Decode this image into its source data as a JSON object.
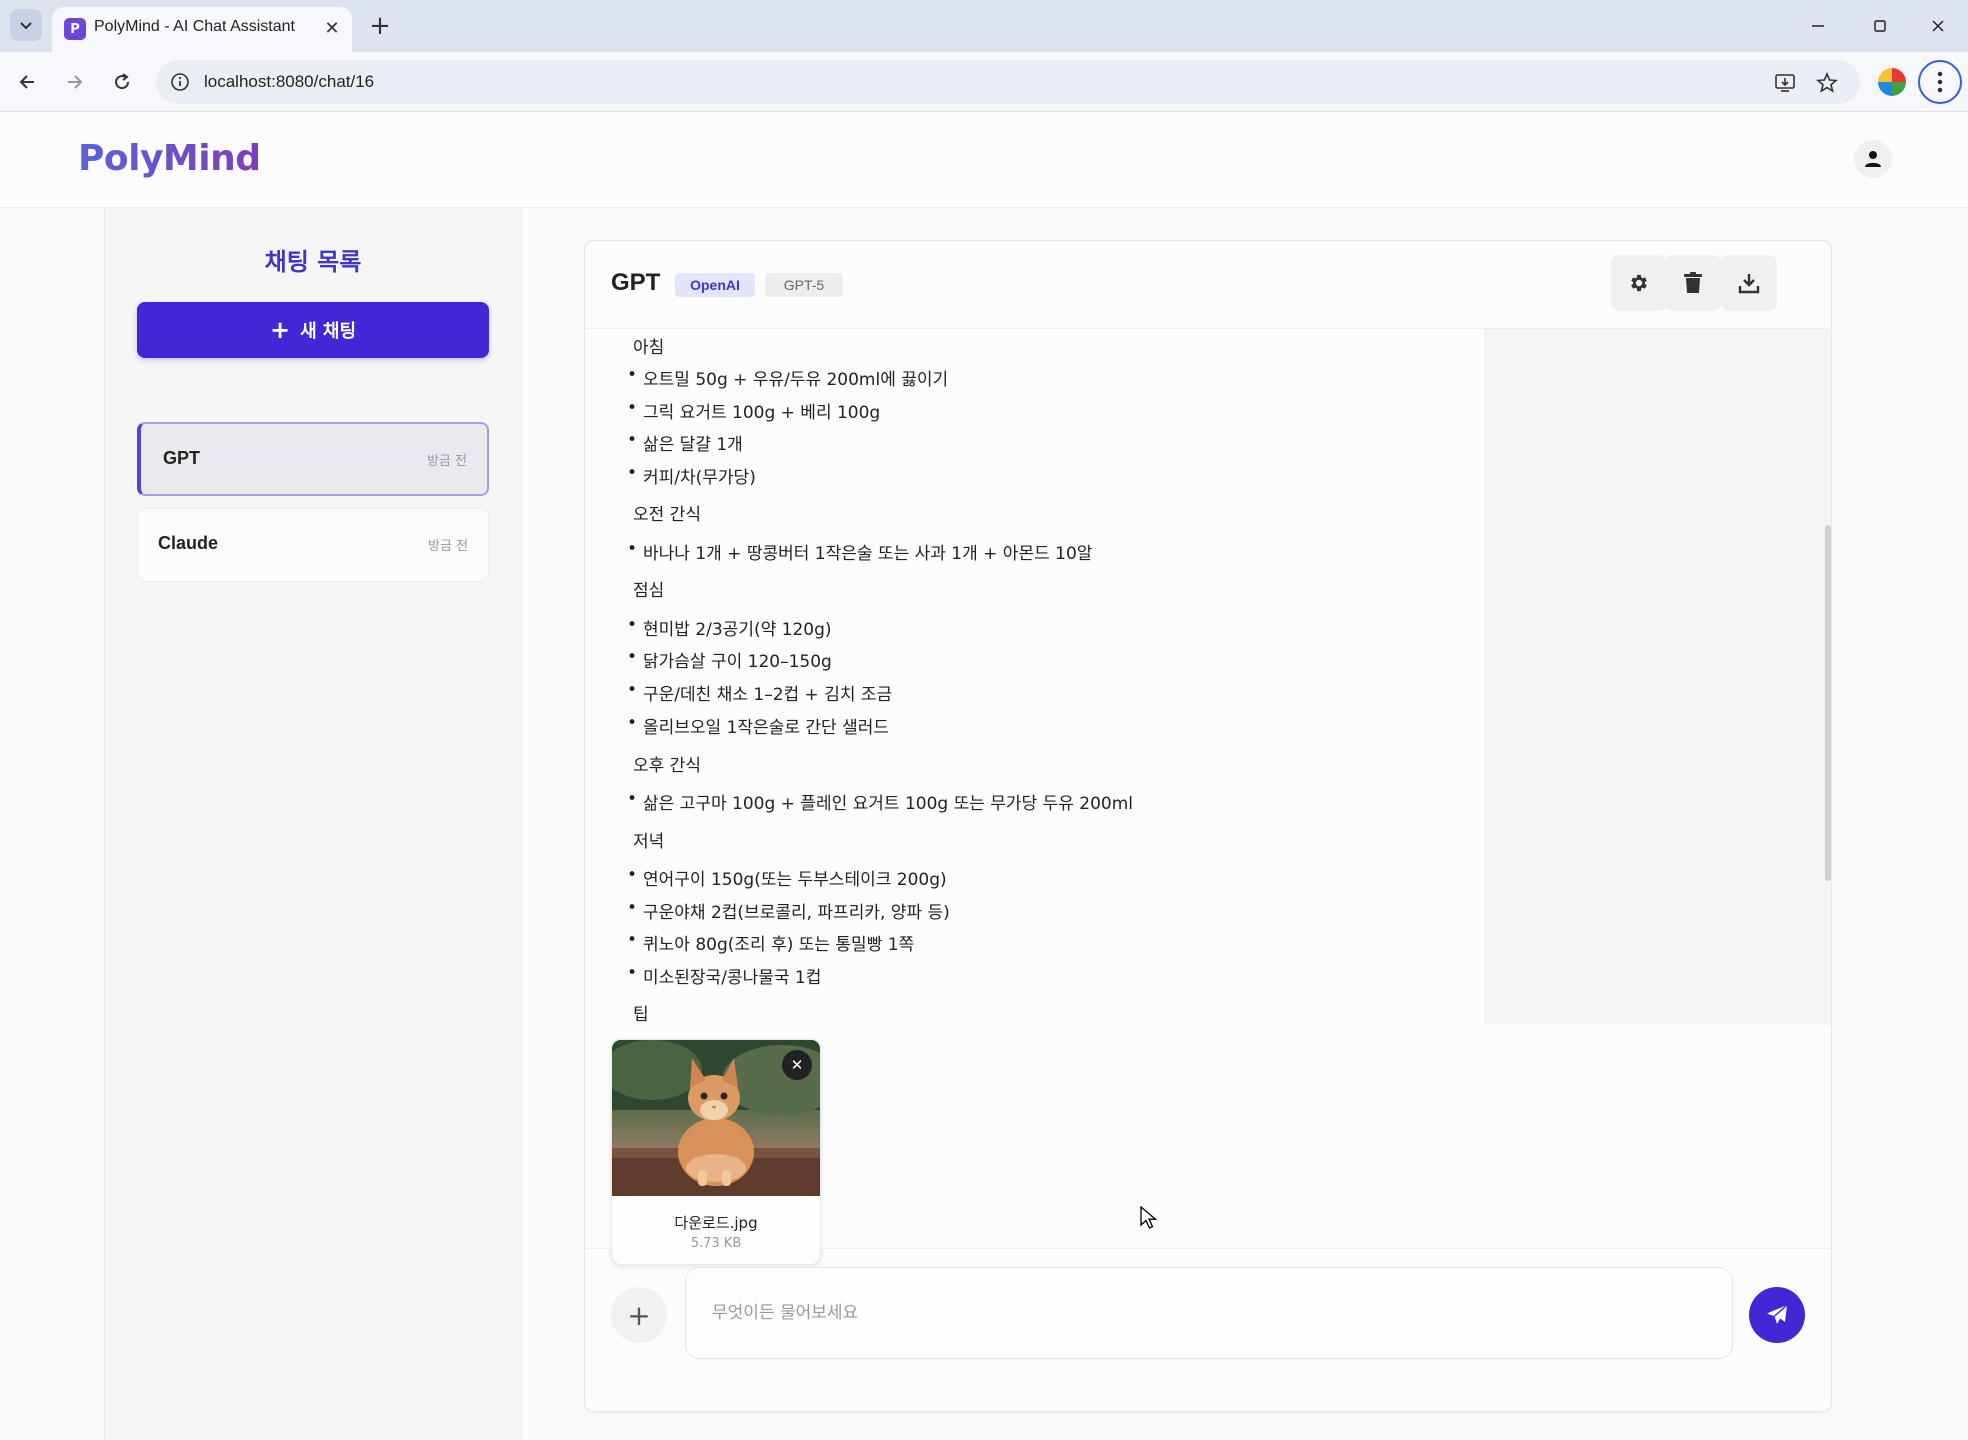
{
  "browser": {
    "tab_title": "PolyMind - AI Chat Assistant",
    "tab_favicon_letter": "P",
    "close_glyph": "✕",
    "new_tab_glyph": "+",
    "url": "localhost:8080/chat/16"
  },
  "header": {
    "logo": "PolyMind"
  },
  "sidebar": {
    "title": "채팅 목록",
    "new_chat_label": "새 채팅",
    "new_chat_plus": "+",
    "chats": [
      {
        "name": "GPT",
        "time": "방금 전",
        "active": true
      },
      {
        "name": "Claude",
        "time": "방금 전",
        "active": false
      }
    ]
  },
  "chat": {
    "model_name": "GPT",
    "provider_badge": "OpenAI",
    "version_badge": "GPT-5",
    "message": {
      "sections": [
        {
          "title": "아침",
          "items": [
            "오트밀 50g + 우유/두유 200ml에 끓이기",
            "그릭 요거트 100g + 베리 100g",
            "삶은 달걀 1개",
            "커피/차(무가당)"
          ]
        },
        {
          "title": "오전 간식",
          "items": [
            "바나나 1개 + 땅콩버터 1작은술 또는 사과 1개 + 아몬드 10알"
          ]
        },
        {
          "title": "점심",
          "items": [
            "현미밥 2/3공기(약 120g)",
            "닭가슴살 구이 120–150g",
            "구운/데친 채소 1–2컵 + 김치 조금",
            "올리브오일 1작은술로 간단 샐러드"
          ]
        },
        {
          "title": "오후 간식",
          "items": [
            "삶은 고구마 100g + 플레인 요거트 100g 또는 무가당 두유 200ml"
          ]
        },
        {
          "title": "저녁",
          "items": [
            "연어구이 150g(또는 두부스테이크 200g)",
            "구운야채 2컵(브로콜리, 파프리카, 양파 등)",
            "퀴노아 80g(조리 후) 또는 통밀빵 1쪽",
            "미소된장국/콩나물국 1컵"
          ]
        },
        {
          "title": "팁",
          "items": []
        }
      ]
    },
    "attachment": {
      "file_name": "다운로드.jpg",
      "file_size": "5.73 KB",
      "remove_glyph": "✕"
    },
    "input": {
      "placeholder": "무엇이든 물어보세요",
      "add_glyph": "+"
    }
  },
  "colors": {
    "accent": "#4326d6",
    "logo_gradient_start": "#5b63d8",
    "logo_gradient_end": "#7e3fb8",
    "badge_bg": "#e3e5fb"
  }
}
